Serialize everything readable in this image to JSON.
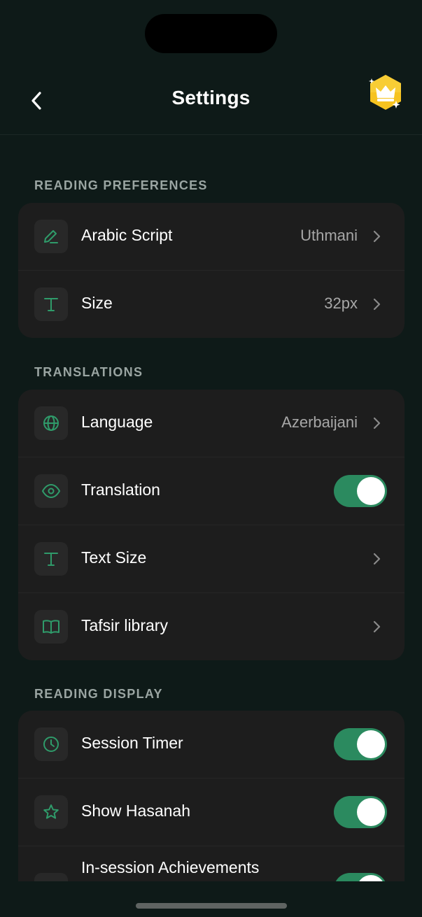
{
  "header": {
    "title": "Settings",
    "back_icon": "chevron-left-icon",
    "premium_icon": "crown-icon"
  },
  "colors": {
    "background": "#0e1a18",
    "card": "#1d1d1d",
    "accent": "#2b8a5f",
    "muted_text": "#a7a7a7"
  },
  "sections": {
    "reading_preferences": {
      "title": "READING PREFERENCES",
      "items": [
        {
          "label": "Arabic Script",
          "value": "Uthmani",
          "icon": "pen-icon",
          "control": "chevron"
        },
        {
          "label": "Size",
          "value": "32px",
          "icon": "text-icon",
          "control": "chevron"
        }
      ]
    },
    "translations": {
      "title": "TRANSLATIONS",
      "items": [
        {
          "label": "Language",
          "value": "Azerbaijani",
          "icon": "globe-icon",
          "control": "chevron"
        },
        {
          "label": "Translation",
          "icon": "eye-icon",
          "control": "toggle",
          "on": true
        },
        {
          "label": "Text Size",
          "icon": "text-icon",
          "control": "chevron"
        },
        {
          "label": "Tafsir library",
          "icon": "book-icon",
          "control": "chevron"
        }
      ]
    },
    "reading_display": {
      "title": "READING DISPLAY",
      "items": [
        {
          "label": "Session Timer",
          "icon": "clock-icon",
          "control": "toggle",
          "on": true
        },
        {
          "label": "Show Hasanah",
          "icon": "star-icon",
          "control": "toggle",
          "on": true
        },
        {
          "label": "In-session Achievements",
          "icon": "trophy-icon",
          "control": "toggle",
          "on": true
        }
      ]
    }
  }
}
